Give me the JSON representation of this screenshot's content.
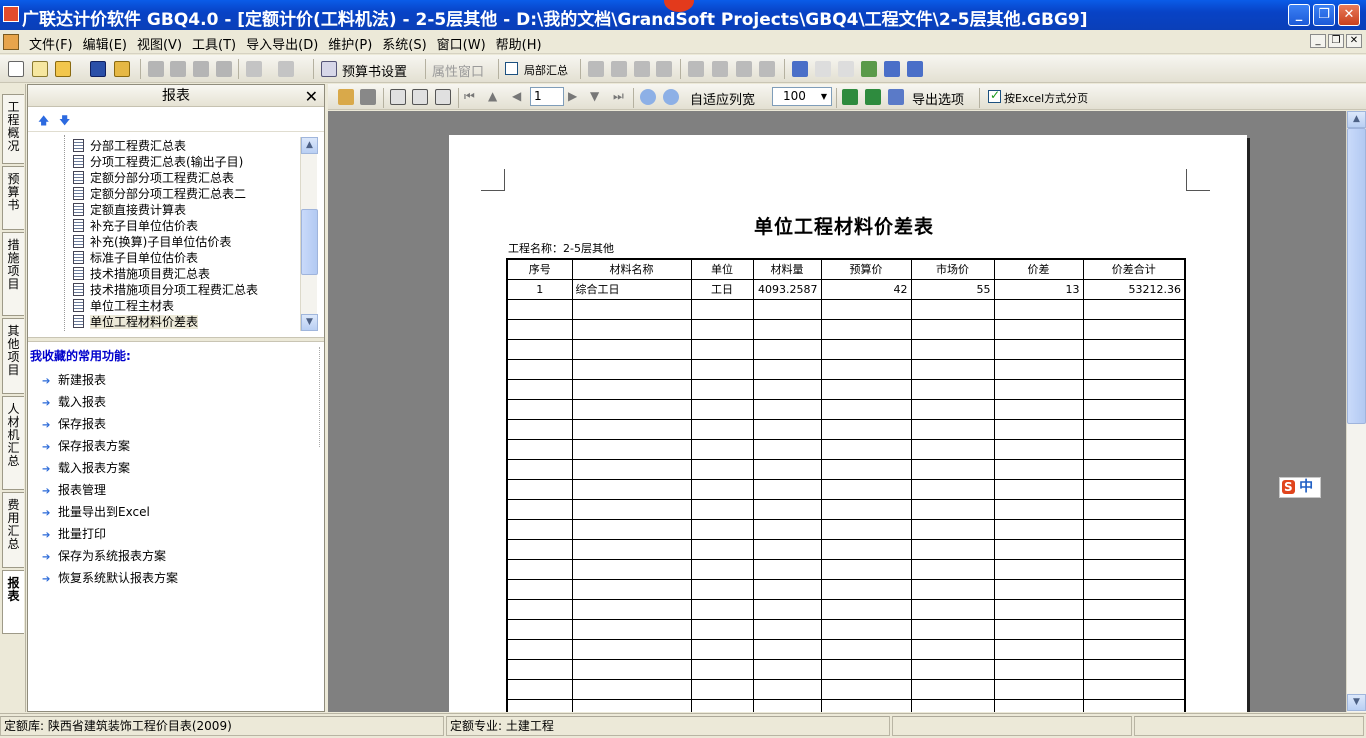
{
  "window": {
    "title": "广联达计价软件 GBQ4.0 - [定额计价(工料机法) - 2-5层其他 - D:\\我的文档\\GrandSoft Projects\\GBQ4\\工程文件\\2-5层其他.GBG9]",
    "minimize": "_",
    "restore": "❐",
    "close": "✕"
  },
  "menu": {
    "items": [
      "文件(F)",
      "编辑(E)",
      "视图(V)",
      "工具(T)",
      "导入导出(D)",
      "维护(P)",
      "系统(S)",
      "窗口(W)",
      "帮助(H)"
    ],
    "mdi_min": "_",
    "mdi_restore": "❐",
    "mdi_close": "✕"
  },
  "toolbar": {
    "budget_settings": "预算书设置",
    "property_window": "属性窗口",
    "local_summary": "局部汇总"
  },
  "side_tabs": [
    "工程概况",
    "预算书",
    "措施项目",
    "其他项目",
    "人材机汇总",
    "费用汇总",
    "报表"
  ],
  "panel": {
    "title": "报表",
    "close": "✕",
    "up_arrow": "🡅",
    "down_arrow": "🡇",
    "tree_items": [
      "分部工程费汇总表",
      "分项工程费汇总表(输出子目)",
      "定额分部分项工程费汇总表",
      "定额分部分项工程费汇总表二",
      "定额直接费计算表",
      "补充子目单位估价表",
      "补充(换算)子目单位估价表",
      "标准子目单位估价表",
      "技术措施项目费汇总表",
      "技术措施项目分项工程费汇总表",
      "单位工程主材表",
      "单位工程材料价差表"
    ],
    "selected_index": 11,
    "favorites_title": "我收藏的常用功能:",
    "favorites": [
      "新建报表",
      "载入报表",
      "保存报表",
      "保存报表方案",
      "载入报表方案",
      "报表管理",
      "批量导出到Excel",
      "批量打印",
      "保存为系统报表方案",
      "恢复系统默认报表方案"
    ]
  },
  "report_toolbar": {
    "page": "1",
    "fit_columns": "自适应列宽",
    "zoom": "100",
    "export_options": "导出选项",
    "excel_paging": "按Excel方式分页"
  },
  "report": {
    "title": "单位工程材料价差表",
    "project_name": "工程名称：2-5层其他",
    "headers": [
      "序号",
      "材料名称",
      "单位",
      "材料量",
      "预算价",
      "市场价",
      "价差",
      "价差合计"
    ],
    "rows": [
      [
        "1",
        "综合工日",
        "工日",
        "4093.2587",
        "42",
        "55",
        "13",
        "53212.36"
      ]
    ],
    "empty_rows": 21
  },
  "ime": {
    "brand": "S",
    "mode": "中"
  },
  "status": {
    "quota_library": "定额库: 陕西省建筑装饰工程价目表(2009)",
    "quota_specialty": "定额专业: 土建工程"
  },
  "colors": {
    "title_bar": "#0843c6",
    "preview_background": "#808080",
    "favorites_title": "#0000cc"
  }
}
